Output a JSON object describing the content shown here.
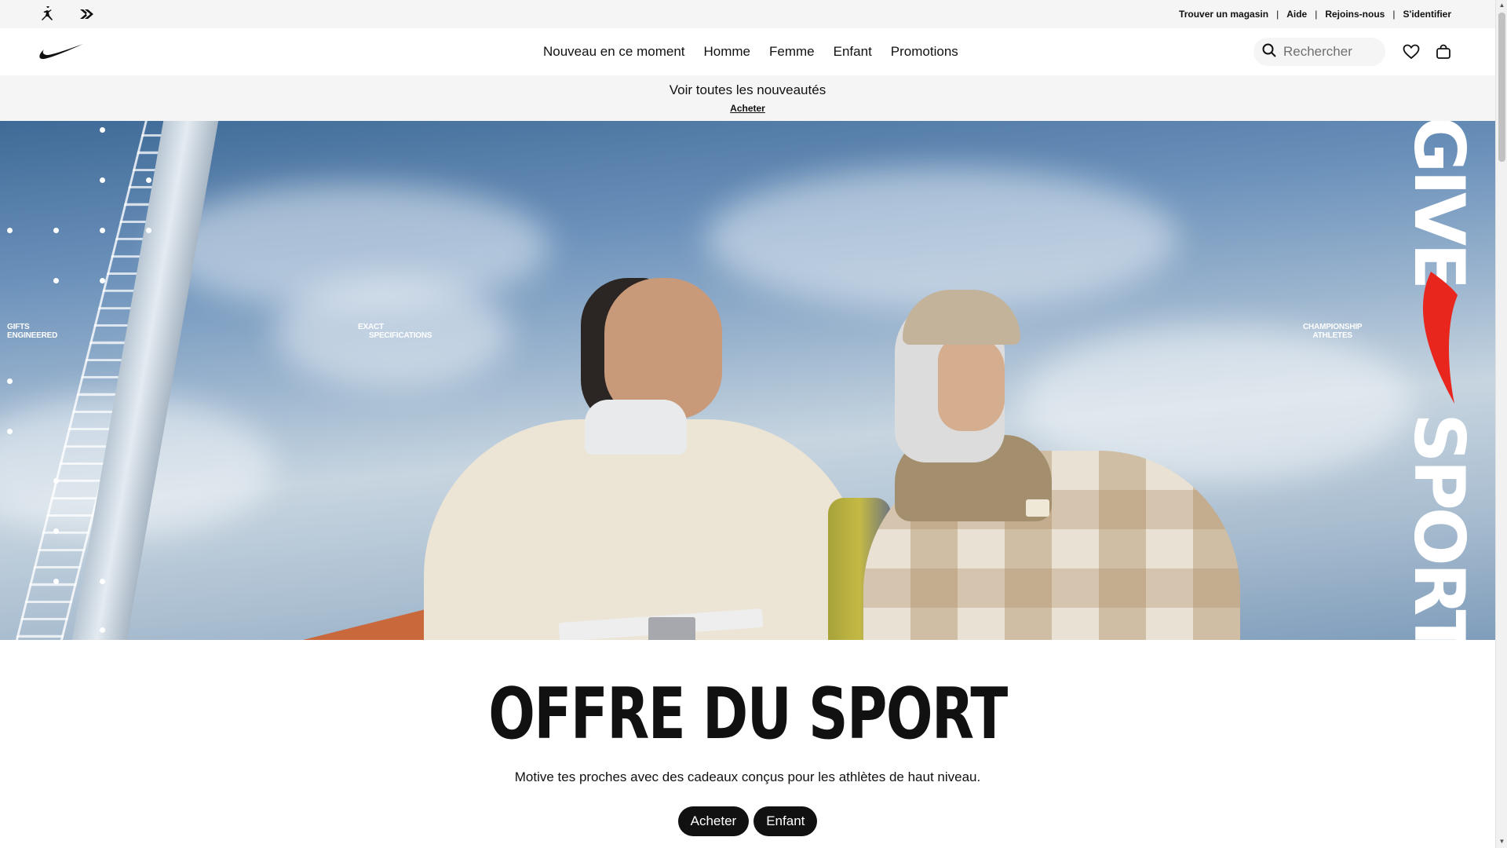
{
  "utility_bar": {
    "brand_icons": [
      "jordan-jumpman-icon",
      "converse-icon"
    ],
    "links": [
      "Trouver un magasin",
      "Aide",
      "Rejoins-nous",
      "S'identifier"
    ],
    "separator": "|"
  },
  "header": {
    "logo": "nike-swoosh-icon",
    "nav": [
      "Nouveau en ce moment",
      "Homme",
      "Femme",
      "Enfant",
      "Promotions"
    ],
    "search_placeholder": "Rechercher",
    "icons": [
      "search-icon",
      "heart-icon",
      "bag-icon"
    ]
  },
  "promo": {
    "title": "Voir toutes les nouveautés",
    "link": "Acheter"
  },
  "hero": {
    "captions": [
      [
        "GIFTS",
        "ENGINEERED"
      ],
      [
        "EXACT",
        "SPECIFICATIONS"
      ],
      [
        "CHAMPIONSHIP",
        "ATHLETES"
      ]
    ],
    "vertical_text_top": "GIVE",
    "vertical_text_bottom": "SPORT",
    "accent_color": "#e8261d"
  },
  "main": {
    "headline": "OFFRE DU SPORT",
    "subtitle": "Motive tes proches avec des cadeaux conçus pour les athlètes de haut niveau.",
    "buttons": [
      "Acheter",
      "Enfant"
    ]
  }
}
